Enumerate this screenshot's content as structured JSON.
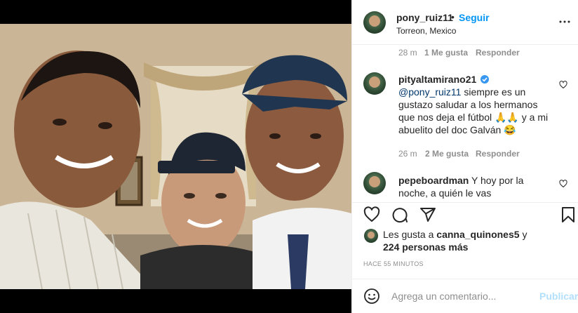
{
  "post": {
    "username": "pony_ruiz11",
    "separator": "•",
    "follow_label": "Seguir",
    "location": "Torreon, Mexico"
  },
  "comments": [
    {
      "time": "28 m",
      "likes": "1 Me gusta",
      "reply": "Responder"
    },
    {
      "username": "pityaltamirano21",
      "mention": "@pony_ruiz11",
      "text_1": "siempre es un gustazo saludar a los hermanos que nos deja el fútbol",
      "emoji_1": "🙏🙏",
      "text_2": "y a mi abuelito del doc Galván",
      "emoji_2": "😂",
      "time": "26 m",
      "likes": "2 Me gusta",
      "reply": "Responder"
    },
    {
      "username": "pepeboardman",
      "text": "Y hoy por la noche, a quién le vas"
    }
  ],
  "likes": {
    "prefix": "Les gusta a",
    "user": "canna_quinones5",
    "and": "y",
    "count": "224 personas más"
  },
  "time_ago": "HACE 55 MINUTOS",
  "add_comment": {
    "placeholder": "Agrega un comentario...",
    "publish_label": "Publicar"
  },
  "icons": {
    "more": "more-options-icon",
    "like": "heart-icon",
    "comment": "comment-icon",
    "share": "share-icon",
    "save": "bookmark-icon",
    "emoji": "emoji-icon"
  },
  "colors": {
    "accent": "#0095f6",
    "publish_disabled": "#b2dffc",
    "mention": "#00376b",
    "muted": "#8e8e8e",
    "text": "#262626"
  }
}
